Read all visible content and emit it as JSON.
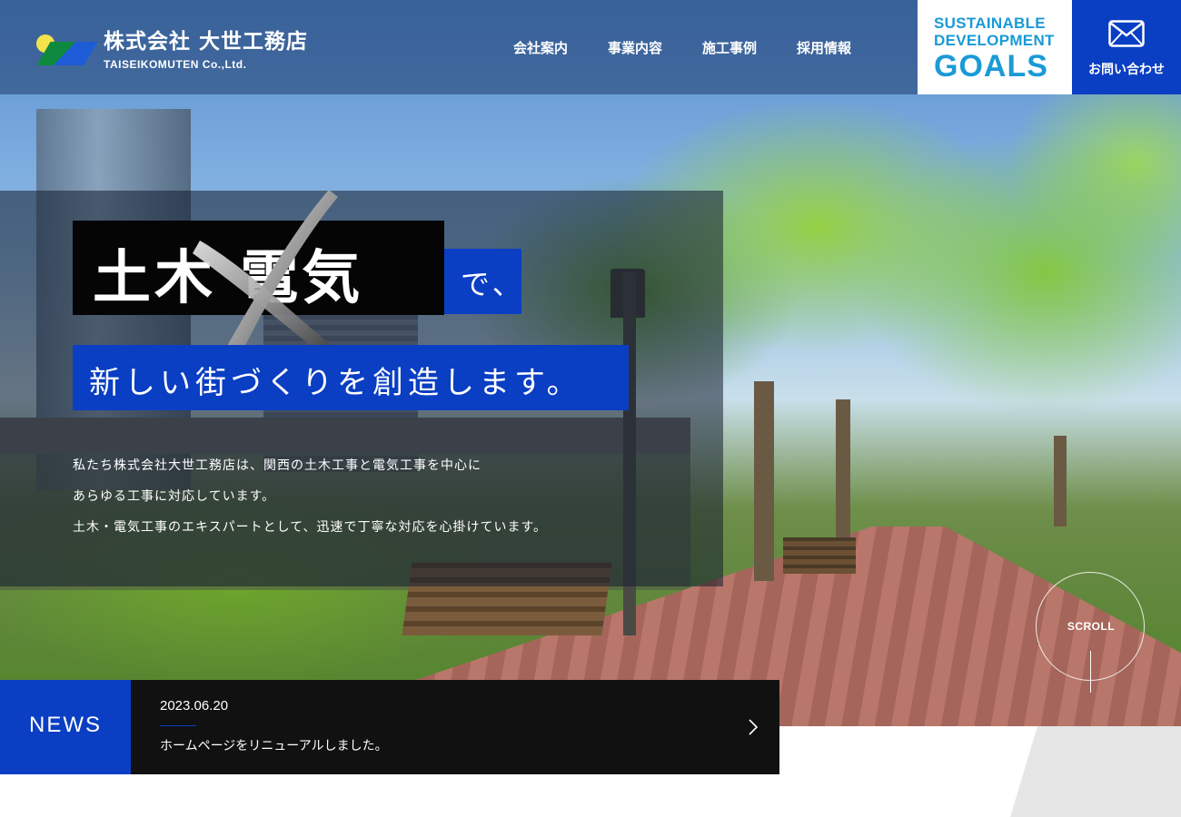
{
  "header": {
    "company_name": "株式会社 大世工務店",
    "company_name_en": "TAISEIKOMUTEN Co.,Ltd.",
    "nav": [
      {
        "label": "会社案内"
      },
      {
        "label": "事業内容"
      },
      {
        "label": "施工事例"
      },
      {
        "label": "採用情報"
      }
    ],
    "sdgs": {
      "line1": "SUSTAINABLE",
      "line2": "DEVELOPMENT",
      "line3": "GOALS"
    },
    "contact_label": "お問い合わせ"
  },
  "hero": {
    "catch_main": "土木 電気",
    "catch_de": "で、",
    "catch_sub": "新しい街づくりを創造します。",
    "lead": [
      "私たち株式会社大世工務店は、関西の土木工事と電気工事を中心に",
      "あらゆる工事に対応しています。",
      "土木・電気工事のエキスパートとして、迅速で丁寧な対応を心掛けています。"
    ],
    "scroll_label": "SCROLL"
  },
  "news": {
    "label": "NEWS",
    "date": "2023.06.20",
    "title": "ホームページをリニューアルしました。"
  },
  "colors": {
    "brand_blue": "#0a3ec3",
    "sdg_blue": "#1a9ad6",
    "news_bg": "#111111"
  },
  "icons": [
    "logo-mark",
    "mail-icon",
    "cross-x-icon",
    "chevron-right-icon"
  ]
}
